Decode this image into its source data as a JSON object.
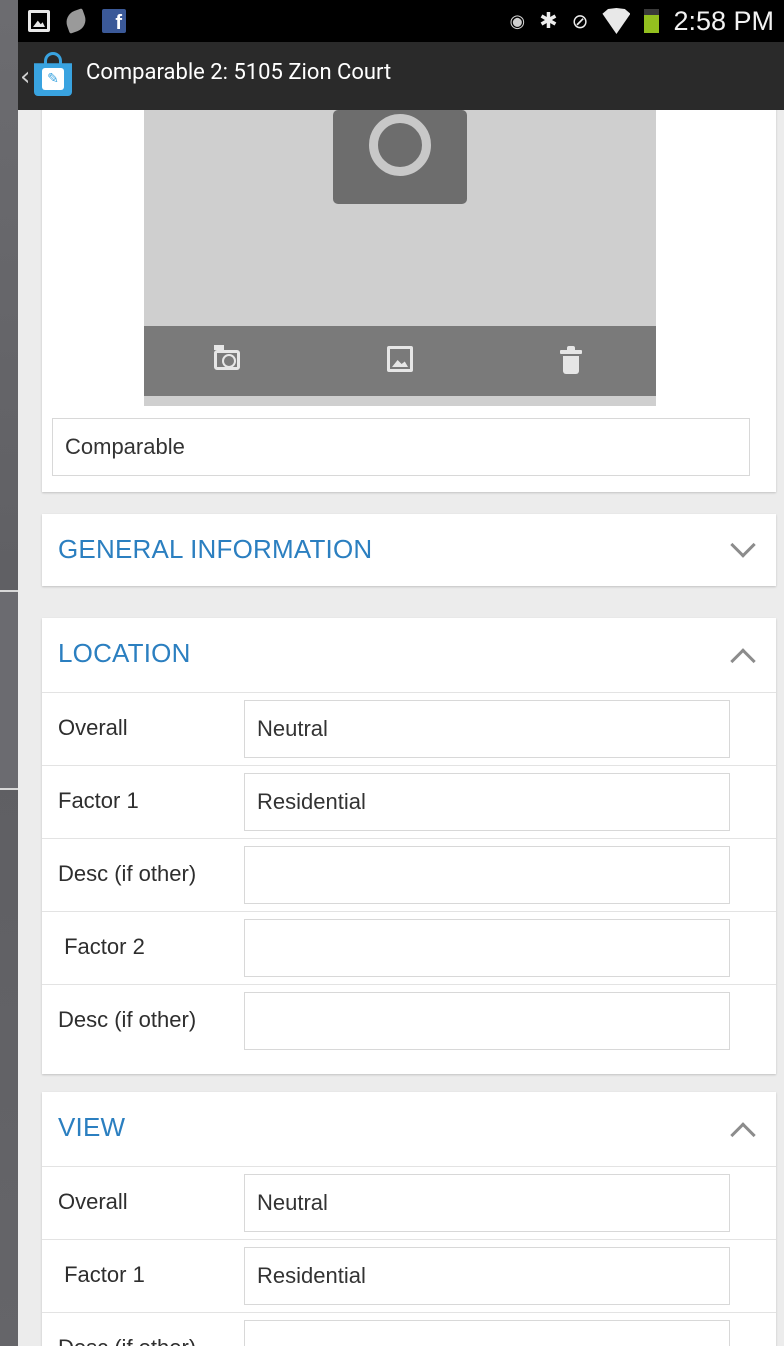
{
  "status_bar": {
    "time": "2:58 PM",
    "icons": [
      "gallery-notification-icon",
      "leaf-notification-icon",
      "facebook-icon",
      "eye-icon",
      "bluetooth-icon",
      "no-signal-icon",
      "wifi-icon",
      "battery-icon"
    ]
  },
  "action_bar": {
    "title": "Comparable 2: 5105 Zion Court"
  },
  "photo": {
    "label_value": "Comparable"
  },
  "sections": {
    "general": {
      "title": "GENERAL INFORMATION",
      "expanded": false
    },
    "location": {
      "title": "LOCATION",
      "expanded": true,
      "rows": [
        {
          "label": "Overall",
          "value": "Neutral"
        },
        {
          "label": "Factor 1",
          "value": "Residential"
        },
        {
          "label": "Desc (if other)",
          "value": ""
        },
        {
          "label": " Factor 2",
          "value": ""
        },
        {
          "label": "Desc (if other)",
          "value": ""
        }
      ]
    },
    "view": {
      "title": "VIEW",
      "expanded": true,
      "rows": [
        {
          "label": "Overall",
          "value": "Neutral"
        },
        {
          "label": " Factor 1",
          "value": "Residential"
        },
        {
          "label": "Desc (if other)",
          "value": ""
        }
      ]
    }
  },
  "colors": {
    "accent_blue": "#2b7fc0",
    "status_bar": "#000000",
    "action_bar": "#2a2a2a",
    "content_bg": "#ececec",
    "battery": "#93c01f"
  }
}
